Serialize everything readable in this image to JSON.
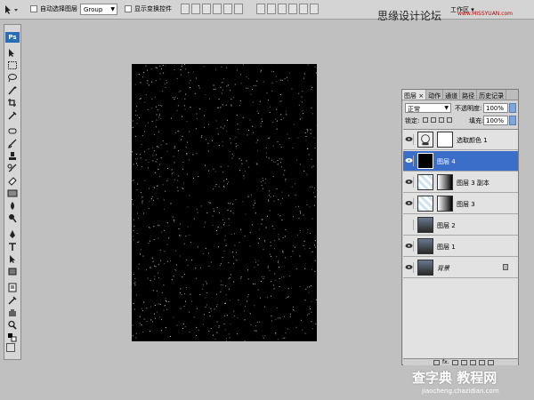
{
  "options_bar": {
    "auto_select_label": "自动选择图层",
    "auto_select_value": "Group",
    "show_transform_label": "显示变换控件",
    "workspace_label": "工作区 ▾"
  },
  "brand": {
    "name": "思缘设计论坛",
    "url": "www.MISSYUAN.com"
  },
  "toolbox": {
    "logo": "Ps"
  },
  "layers_panel": {
    "tabs": [
      "图层 ×",
      "动作",
      "通道",
      "路径",
      "历史记录"
    ],
    "blend_mode": "正常",
    "opacity_label": "不透明度:",
    "opacity_value": "100%",
    "lock_label": "锁定:",
    "fill_label": "填充:",
    "fill_value": "100%",
    "layers": [
      {
        "name": "选取颜色 1",
        "visible": true,
        "selected": false,
        "type": "adjustment"
      },
      {
        "name": "图层 4",
        "visible": true,
        "selected": true,
        "type": "black"
      },
      {
        "name": "图层 3 副本",
        "visible": true,
        "selected": false,
        "type": "masked"
      },
      {
        "name": "图层 3",
        "visible": true,
        "selected": false,
        "type": "masked"
      },
      {
        "name": "图层 2",
        "visible": false,
        "selected": false,
        "type": "photo"
      },
      {
        "name": "图层 1",
        "visible": true,
        "selected": false,
        "type": "photo"
      },
      {
        "name": "背景",
        "visible": true,
        "selected": false,
        "type": "photo",
        "locked": true
      }
    ],
    "footer_fx": "fx."
  },
  "watermark": {
    "text": "查字典 教程网",
    "url": "jiaocheng.chazidian.com"
  },
  "colors": {
    "selection": "#3a6ec8",
    "canvas": "#000000",
    "workspace": "#c0c0c0"
  }
}
